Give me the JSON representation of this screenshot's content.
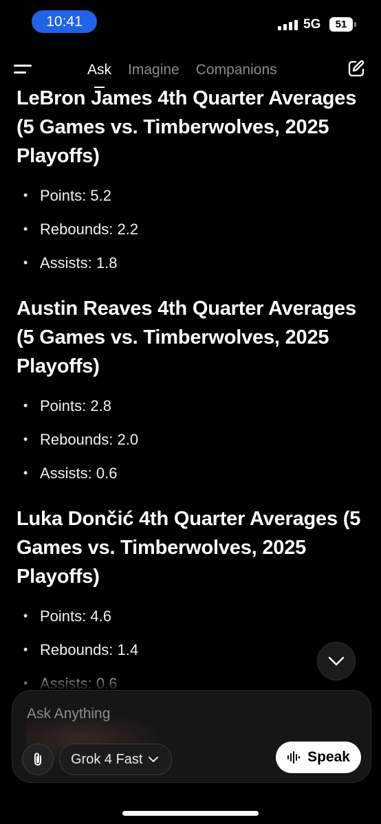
{
  "status_bar": {
    "time": "10:41",
    "network": "5G",
    "battery": "51"
  },
  "nav": {
    "tabs": [
      {
        "label": "Ask",
        "active": true
      },
      {
        "label": "Imagine",
        "active": false
      },
      {
        "label": "Companions",
        "active": false
      }
    ]
  },
  "sections": [
    {
      "heading": "LeBron James 4th Quarter Averages (5 Games vs. Timberwolves, 2025 Playoffs)",
      "stats": [
        "Points: 5.2",
        "Rebounds: 2.2",
        "Assists: 1.8"
      ]
    },
    {
      "heading": "Austin Reaves 4th Quarter Averages (5 Games vs. Timberwolves, 2025 Playoffs)",
      "stats": [
        "Points: 2.8",
        "Rebounds: 2.0",
        "Assists: 0.6"
      ]
    },
    {
      "heading": "Luka Dončić 4th Quarter Averages (5 Games vs. Timberwolves, 2025 Playoffs)",
      "stats": [
        "Points: 4.6",
        "Rebounds: 1.4",
        "Assists: 0.6"
      ]
    }
  ],
  "composer": {
    "placeholder": "Ask Anything",
    "model": "Grok 4 Fast",
    "speak_label": "Speak"
  },
  "colors": {
    "background": "#000000",
    "time_pill": "#1f63e8",
    "inactive_tab": "#8a8a8a"
  }
}
